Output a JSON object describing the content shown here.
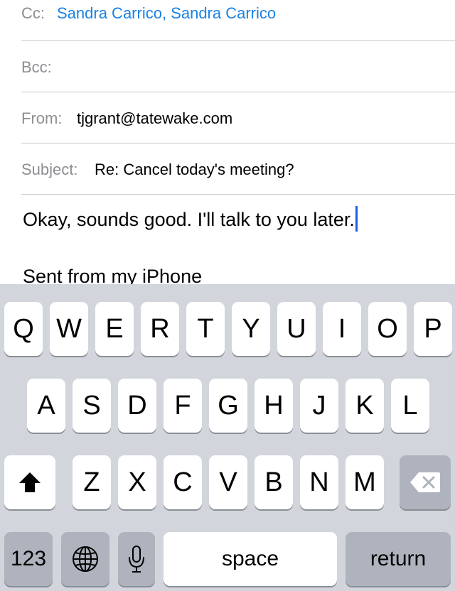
{
  "compose": {
    "cc": {
      "label": "Cc:",
      "value": "Sandra Carrico, Sandra Carrico"
    },
    "bcc": {
      "label": "Bcc:",
      "value": ""
    },
    "from": {
      "label": "From:",
      "value": "tjgrant@tatewake.com"
    },
    "subject": {
      "label": "Subject:",
      "value": "Re: Cancel today's meeting?"
    },
    "body": {
      "line1": "Okay, sounds good. I'll talk to you later.",
      "signature": "Sent from my iPhone"
    }
  },
  "keyboard": {
    "row1": [
      "Q",
      "W",
      "E",
      "R",
      "T",
      "Y",
      "U",
      "I",
      "O",
      "P"
    ],
    "row2": [
      "A",
      "S",
      "D",
      "F",
      "G",
      "H",
      "J",
      "K",
      "L"
    ],
    "row3": [
      "Z",
      "X",
      "C",
      "V",
      "B",
      "N",
      "M"
    ],
    "numbers_label": "123",
    "space_label": "space",
    "return_label": "return",
    "icons": {
      "shift": "shift-arrow-icon",
      "delete": "backspace-icon",
      "globe": "globe-icon",
      "mic": "microphone-icon"
    }
  },
  "colors": {
    "link_blue": "#1a82e2",
    "cursor_blue": "#1a5fe0",
    "label_gray": "#8e8e93",
    "keyboard_bg": "#d2d5db",
    "dark_key": "#aeb3bd"
  }
}
